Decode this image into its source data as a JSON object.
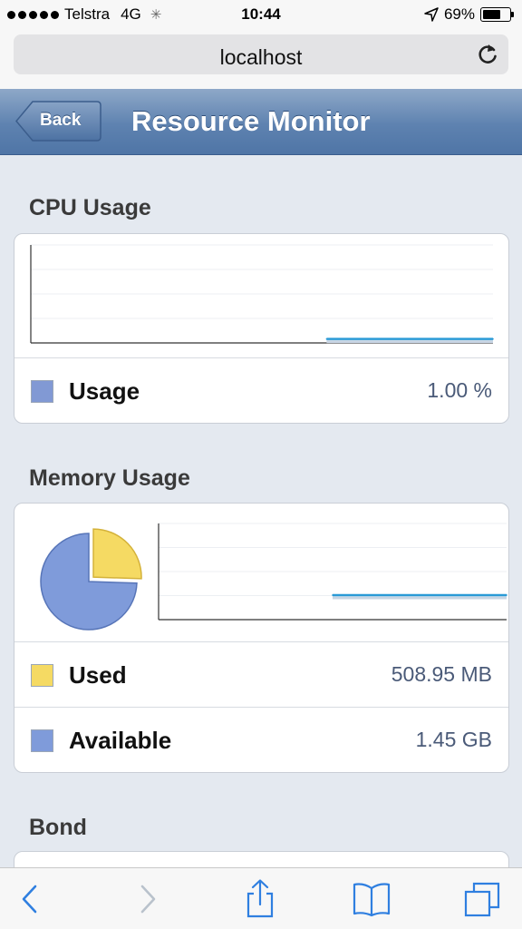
{
  "status_bar": {
    "carrier": "Telstra",
    "network": "4G",
    "time": "10:44",
    "battery_text": "69%",
    "battery_level": 0.69
  },
  "browser": {
    "url": "localhost"
  },
  "nav": {
    "back_label": "Back",
    "title": "Resource Monitor"
  },
  "cpu": {
    "section_title": "CPU Usage",
    "usage_label": "Usage",
    "usage_value": "1.00 %",
    "swatch_color": "#8199d4"
  },
  "memory": {
    "section_title": "Memory Usage",
    "used_label": "Used",
    "used_value": "508.95 MB",
    "used_color": "#f5da63",
    "available_label": "Available",
    "available_value": "1.45 GB",
    "available_color": "#7f9bda"
  },
  "bond": {
    "section_title": "Bond"
  },
  "colors": {
    "line": "#2a9ad6",
    "nav_gradient": "#5e82b0",
    "toolbar_icon": "#2f7fe0"
  },
  "icons": [
    "reload-icon",
    "back-arrow-icon",
    "forward-arrow-icon",
    "share-icon",
    "bookmarks-icon",
    "tabs-icon"
  ],
  "chart_data": [
    {
      "type": "line",
      "name": "cpu-usage-history",
      "x": [
        0,
        1,
        2,
        3,
        4,
        5,
        6
      ],
      "y": [
        1,
        1,
        1,
        1,
        1,
        1,
        1
      ],
      "ylim": [
        0,
        25
      ],
      "grid": true
    },
    {
      "type": "pie",
      "name": "memory-breakdown",
      "categories": [
        "Used",
        "Available"
      ],
      "values": [
        508.95,
        1484.8
      ],
      "colors": [
        "#f5da63",
        "#7f9bda"
      ]
    },
    {
      "type": "line",
      "name": "memory-usage-history",
      "x": [
        0,
        1,
        2,
        3,
        4,
        5,
        6
      ],
      "y": [
        25.5,
        25.5,
        25.5,
        25.5,
        25.5,
        25.5,
        25.5
      ],
      "ylim": [
        0,
        100
      ],
      "grid": true
    }
  ]
}
